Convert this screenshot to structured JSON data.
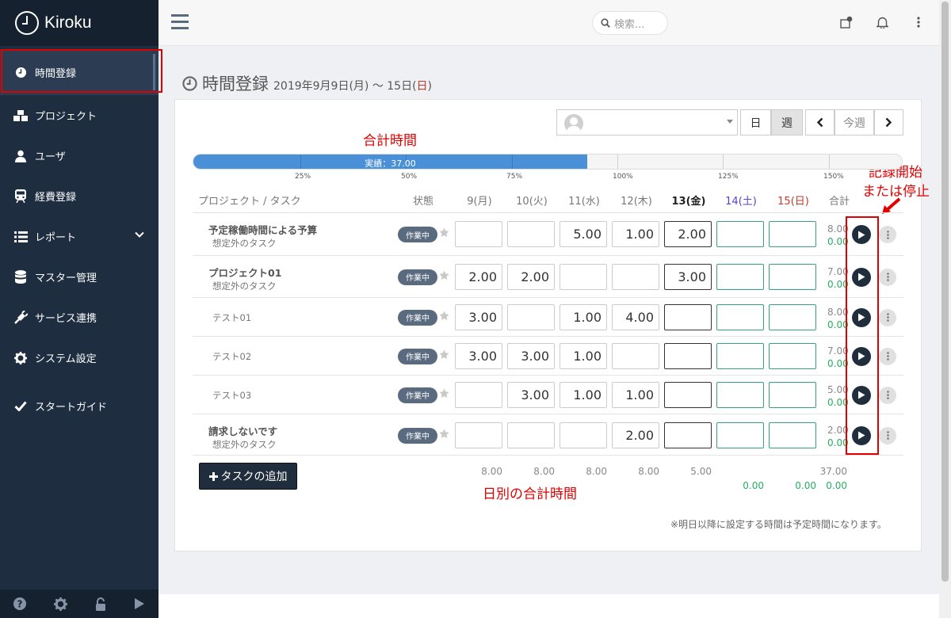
{
  "app": {
    "name": "Kiroku"
  },
  "sidebar": {
    "items": [
      {
        "key": "time",
        "label": "時間登録",
        "icon": "clock-icon"
      },
      {
        "key": "project",
        "label": "プロジェクト",
        "icon": "cubes-icon"
      },
      {
        "key": "user",
        "label": "ユーザ",
        "icon": "user-icon"
      },
      {
        "key": "expense",
        "label": "経費登録",
        "icon": "train-icon"
      },
      {
        "key": "report",
        "label": "レポート",
        "icon": "list-icon"
      },
      {
        "key": "master",
        "label": "マスター管理",
        "icon": "database-icon"
      },
      {
        "key": "service",
        "label": "サービス連携",
        "icon": "plug-icon"
      },
      {
        "key": "settings",
        "label": "システム設定",
        "icon": "gear-icon"
      },
      {
        "key": "guide",
        "label": "スタートガイド",
        "icon": "check-icon"
      }
    ],
    "footer_icons": [
      "help-icon",
      "gear-icon",
      "unlock-icon",
      "play-icon"
    ]
  },
  "topbar": {
    "search_placeholder": "検索..."
  },
  "page": {
    "title": "時間登録",
    "range_prefix": "2019年9月9日(月) 〜 15日(",
    "range_sun": "日",
    "range_suffix": ")"
  },
  "controls": {
    "day": "日",
    "week": "週",
    "this_week": "今週"
  },
  "annotations": {
    "total_time": "合計時間",
    "daily_total": "日別の合計時間",
    "record_line1": "記録開始",
    "record_line2": "または停止"
  },
  "progress": {
    "label": "実績：37.00",
    "fraction": 0.555,
    "ticks": [
      "25%",
      "50%",
      "75%",
      "100%",
      "125%",
      "150%"
    ]
  },
  "table": {
    "headers": {
      "task": "プロジェクト / タスク",
      "status": "状態",
      "days": [
        "9(月)",
        "10(火)",
        "11(水)",
        "12(木)",
        "13(金)",
        "14(土)",
        "15(日)"
      ],
      "total": "合計"
    },
    "rows": [
      {
        "name": "予定稼働時間による予算",
        "sub": "想定外のタスク",
        "bold": true,
        "status": "作業中",
        "cells": [
          "",
          "",
          "5.00",
          "1.00",
          "2.00",
          "",
          ""
        ],
        "planned": "8.00",
        "actual": "0.00"
      },
      {
        "name": "プロジェクト01",
        "sub": "想定外のタスク",
        "bold": true,
        "status": "作業中",
        "cells": [
          "2.00",
          "2.00",
          "",
          "",
          "3.00",
          "",
          ""
        ],
        "planned": "7.00",
        "actual": "0.00"
      },
      {
        "name": "テスト01",
        "sub": "",
        "bold": false,
        "status": "作業中",
        "cells": [
          "3.00",
          "",
          "1.00",
          "4.00",
          "",
          "",
          ""
        ],
        "planned": "8.00",
        "actual": "0.00"
      },
      {
        "name": "テスト02",
        "sub": "",
        "bold": false,
        "status": "作業中",
        "cells": [
          "3.00",
          "3.00",
          "1.00",
          "",
          "",
          "",
          ""
        ],
        "planned": "7.00",
        "actual": "0.00"
      },
      {
        "name": "テスト03",
        "sub": "",
        "bold": false,
        "status": "作業中",
        "cells": [
          "",
          "3.00",
          "1.00",
          "1.00",
          "",
          "",
          ""
        ],
        "planned": "5.00",
        "actual": "0.00"
      },
      {
        "name": "請求しないです",
        "sub": "想定外のタスク",
        "bold": true,
        "status": "作業中",
        "cells": [
          "",
          "",
          "",
          "2.00",
          "",
          "",
          ""
        ],
        "planned": "2.00",
        "actual": "0.00"
      }
    ],
    "day_totals": [
      "8.00",
      "8.00",
      "8.00",
      "8.00",
      "5.00"
    ],
    "weekend_actual": [
      "0.00",
      "0.00"
    ],
    "grand_total": "37.00",
    "grand_actual": "0.00"
  },
  "add_task_label": "タスクの追加",
  "note": "※明日以降に設定する時間は予定時間になります。"
}
